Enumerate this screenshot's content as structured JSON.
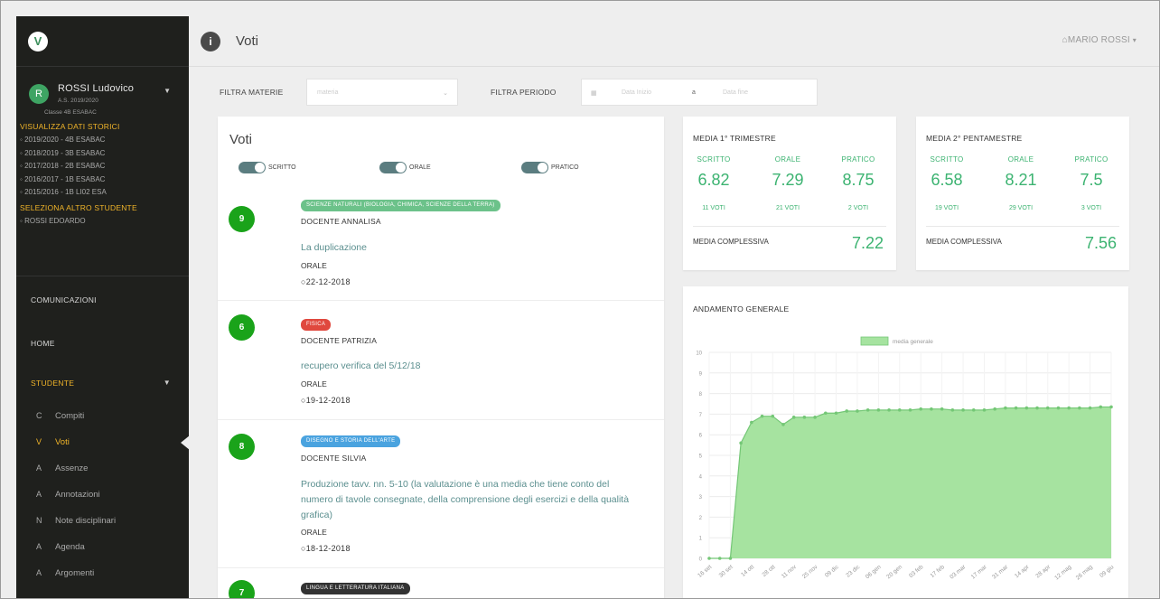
{
  "sidebar": {
    "logo": "V",
    "user": {
      "avatar": "R",
      "name": "ROSSI Ludovico",
      "year": "A.S. 2019/2020",
      "class": "Classe 4B ESABAC"
    },
    "history_title": "VISUALIZZA DATI STORICI",
    "history": [
      "2019/2020 - 4B ESABAC",
      "2018/2019 - 3B ESABAC",
      "2017/2018 - 2B ESABAC",
      "2016/2017 - 1B ESABAC",
      "2015/2016 - 1B LI02 ESA"
    ],
    "other_title": "SELEZIONA ALTRO STUDENTE",
    "other": [
      "ROSSI EDOARDO"
    ],
    "nav": {
      "comunicazioni": "COMUNICAZIONI",
      "home": "HOME",
      "studente": "STUDENTE",
      "items": [
        {
          "letter": "C",
          "label": "Compiti"
        },
        {
          "letter": "V",
          "label": "Voti"
        },
        {
          "letter": "A",
          "label": "Assenze"
        },
        {
          "letter": "A",
          "label": "Annotazioni"
        },
        {
          "letter": "N",
          "label": "Note disciplinari"
        },
        {
          "letter": "A",
          "label": "Agenda"
        },
        {
          "letter": "A",
          "label": "Argomenti"
        }
      ]
    }
  },
  "topbar": {
    "icon": "i",
    "title": "Voti",
    "user": "MARIO ROSSI"
  },
  "filters": {
    "materie_label": "FILTRA MATERIE",
    "materie_placeholder": "materia",
    "periodo_label": "FILTRA PERIODO",
    "start_placeholder": "Data Inizio",
    "sep": "a",
    "end_placeholder": "Data fine"
  },
  "voti": {
    "title": "Voti",
    "toggles": [
      "SCRITTO",
      "ORALE",
      "PRATICO"
    ],
    "entries": [
      {
        "grade": "9",
        "subject": "SCIENZE NATURALI (BIOLOGIA, CHIMICA, SCIENZE DELLA TERRA)",
        "subject_color": "#6cc28a",
        "teacher": "DOCENTE ANNALISA",
        "description": "La duplicazione",
        "type": "ORALE",
        "date": "22-12-2018"
      },
      {
        "grade": "6",
        "subject": "FISICA",
        "subject_color": "#e0483e",
        "teacher": "DOCENTE PATRIZIA",
        "description": "recupero verifica del 5/12/18",
        "type": "ORALE",
        "date": "19-12-2018"
      },
      {
        "grade": "8",
        "subject": "DISEGNO E STORIA DELL'ARTE",
        "subject_color": "#4aa3df",
        "teacher": "DOCENTE SILVIA",
        "description": "Produzione tavv. nn. 5-10 (la valutazione è una media che tiene conto del numero di tavole consegnate, della comprensione degli esercizi e della qualità grafica)",
        "type": "ORALE",
        "date": "18-12-2018"
      },
      {
        "grade": "7",
        "subject": "LINGUA E LETTERATURA ITALIANA",
        "subject_color": "#333333",
        "teacher": "",
        "description": "",
        "type": "",
        "date": ""
      }
    ]
  },
  "media1": {
    "title": "MEDIA 1° TRIMESTRE",
    "cols": [
      {
        "head": "SCRITTO",
        "value": "6.82",
        "count": "11 VOTI"
      },
      {
        "head": "ORALE",
        "value": "7.29",
        "count": "21 VOTI"
      },
      {
        "head": "PRATICO",
        "value": "8.75",
        "count": "2 VOTI"
      }
    ],
    "overall_label": "MEDIA COMPLESSIVA",
    "overall_value": "7.22"
  },
  "media2": {
    "title": "MEDIA 2° PENTAMESTRE",
    "cols": [
      {
        "head": "SCRITTO",
        "value": "6.58",
        "count": "19 VOTI"
      },
      {
        "head": "ORALE",
        "value": "8.21",
        "count": "29 VOTI"
      },
      {
        "head": "PRATICO",
        "value": "7.5",
        "count": "3 VOTI"
      }
    ],
    "overall_label": "MEDIA COMPLESSIVA",
    "overall_value": "7.56"
  },
  "chart_title": "ANDAMENTO GENERALE",
  "colors": {
    "green": "#3cb371",
    "area": "#a6e3a0",
    "line": "#74c776",
    "accent": "#f0b429"
  },
  "chart_data": {
    "type": "area",
    "title": "ANDAMENTO GENERALE",
    "legend": "media generale",
    "legend_position": "top",
    "ylim": [
      0,
      10
    ],
    "yticks": [
      0,
      1,
      2,
      3,
      4,
      5,
      6,
      7,
      8,
      9,
      10
    ],
    "grid": true,
    "x": [
      "16 set",
      "",
      "30 set",
      "",
      "14 ott",
      "",
      "28 ott",
      "",
      "11 nov",
      "",
      "25 nov",
      "",
      "09 dic",
      "",
      "23 dic",
      "",
      "06 gen",
      "",
      "20 gen",
      "",
      "03 feb",
      "",
      "17 feb",
      "",
      "03 mar",
      "",
      "17 mar",
      "",
      "31 mar",
      "",
      "14 apr",
      "",
      "28 apr",
      "",
      "12 mag",
      "",
      "26 mag",
      "",
      "09 giu"
    ],
    "values": [
      0,
      0,
      0,
      5.6,
      6.6,
      6.9,
      6.9,
      6.5,
      6.85,
      6.85,
      6.85,
      7.05,
      7.05,
      7.15,
      7.15,
      7.2,
      7.2,
      7.2,
      7.2,
      7.2,
      7.25,
      7.25,
      7.25,
      7.2,
      7.2,
      7.2,
      7.2,
      7.25,
      7.3,
      7.3,
      7.3,
      7.3,
      7.3,
      7.3,
      7.3,
      7.3,
      7.3,
      7.35,
      7.35
    ]
  }
}
